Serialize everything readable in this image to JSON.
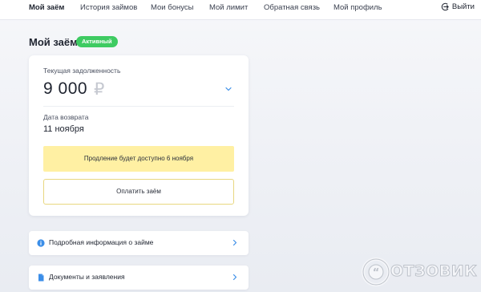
{
  "nav": {
    "items": [
      "Мой заём",
      "История займов",
      "Мои бонусы",
      "Мой лимит",
      "Обратная связь",
      "Мой профиль"
    ],
    "exit_label": "Выйти"
  },
  "page": {
    "title": "Мой заём",
    "status": "Активный"
  },
  "loan": {
    "debt_label": "Текущая задолженность",
    "debt_amount": "9 000",
    "currency": "₽",
    "due_label": "Дата возврата",
    "due_date": "11 ноября",
    "extension_text": "Продление будет доступно 6 ноября",
    "pay_button": "Оплатить заём"
  },
  "rows": [
    {
      "label": "Подробная информация о займе",
      "icon": "info-icon"
    },
    {
      "label": "Документы и заявления",
      "icon": "document-icon"
    }
  ],
  "watermark": {
    "text": "ОТЗОВИК"
  },
  "colors": {
    "accent": "#3ecb62",
    "banner": "#fff0a3",
    "link_blue": "#3b8ee8"
  }
}
